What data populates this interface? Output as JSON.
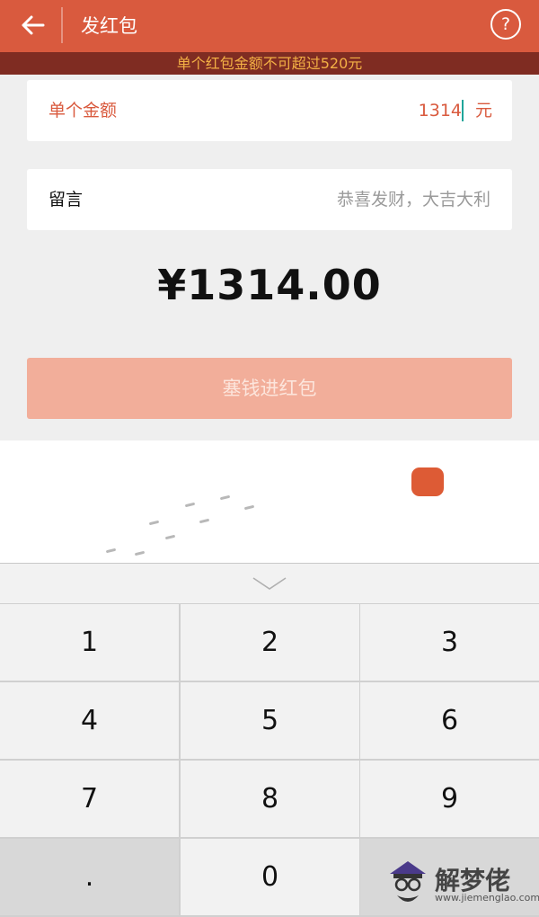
{
  "header": {
    "title": "发红包",
    "back_icon": "arrow-left-icon",
    "help_label": "?"
  },
  "banner": {
    "text": "单个红包金额不可超过520元"
  },
  "amount": {
    "label": "单个金额",
    "value": "1314",
    "unit": "元"
  },
  "message": {
    "label": "留言",
    "placeholder": "恭喜发财，大吉大利"
  },
  "total": {
    "display": "¥1314.00"
  },
  "submit": {
    "label": "塞钱进红包"
  },
  "keyboard": {
    "collapse_icon": "chevron-down-icon",
    "keys": [
      "1",
      "2",
      "3",
      "4",
      "5",
      "6",
      "7",
      "8",
      "9",
      ".",
      "0"
    ]
  },
  "watermark": {
    "text": "解梦佬",
    "url": "www.jiemenglao.com"
  },
  "colors": {
    "accent": "#d95a3e",
    "banner_bg": "#7f2c22",
    "banner_text": "#f3b045",
    "button_disabled": "#f2ae9a"
  }
}
